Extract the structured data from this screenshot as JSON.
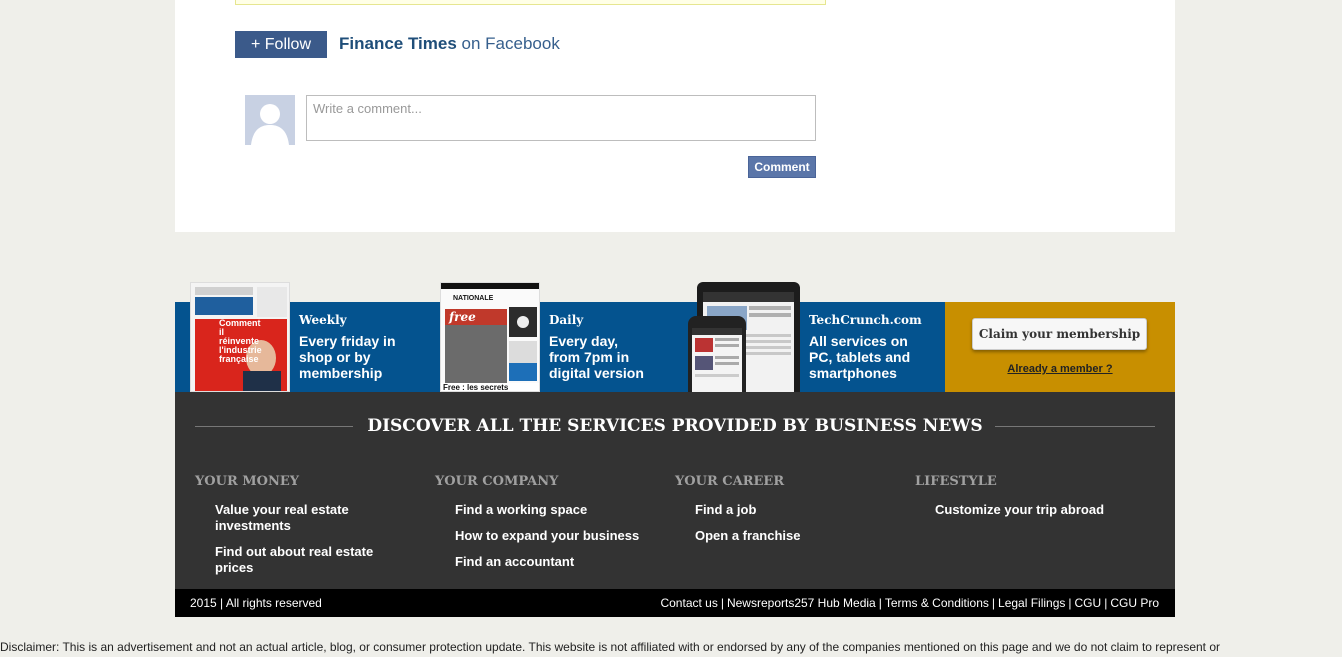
{
  "social": {
    "follow_label": "+ Follow",
    "page_name": "Finance Times",
    "platform_text": "on Facebook"
  },
  "comment": {
    "placeholder": "Write a comment...",
    "submit_label": "Comment"
  },
  "promo": {
    "weekly": {
      "title": "Weekly",
      "text": "Every friday in shop or by membership"
    },
    "daily": {
      "title": "Daily",
      "text": "Every day, from 7pm in digital version"
    },
    "digital": {
      "title": "TechCrunch.com",
      "text": "All services on PC, tablets and smartphones"
    },
    "claim_label": "Claim your membership",
    "already_label": "Already a member ?",
    "mag1": {
      "headline": "Comment il réinvente l'industrie française"
    },
    "mag2": {
      "masthead": "NATIONALE",
      "brand": "free",
      "caption": "Free : les secrets"
    }
  },
  "services": {
    "heading": "DISCOVER ALL THE SERVICES PROVIDED BY BUSINESS NEWS",
    "columns": [
      {
        "title": "YOUR MONEY",
        "items": [
          "Value your real estate investments",
          "Find out about real estate prices"
        ]
      },
      {
        "title": "YOUR COMPANY",
        "items": [
          "Find a working space",
          "How to expand your business",
          "Find an accountant"
        ]
      },
      {
        "title": "YOUR CAREER",
        "items": [
          "Find a job",
          "Open a franchise"
        ]
      },
      {
        "title": "LIFESTYLE",
        "items": [
          "Customize your trip abroad"
        ]
      }
    ]
  },
  "footer": {
    "copyright": "2015 | All rights reserved",
    "links": [
      "Contact us",
      "Newsreports257 Hub Media",
      "Terms & Conditions",
      "Legal Filings",
      "CGU",
      "CGU Pro"
    ]
  },
  "disclaimer": "Disclaimer: This is an advertisement and not an actual article, blog, or consumer protection update. This website is not affiliated with or endorsed by any of the companies mentioned on this page and we do not claim to represent or",
  "colors": {
    "facebook_blue": "#3b5a8a",
    "promo_blue": "#04538f",
    "claim_gold": "#c88f00",
    "services_bg": "#333333"
  }
}
